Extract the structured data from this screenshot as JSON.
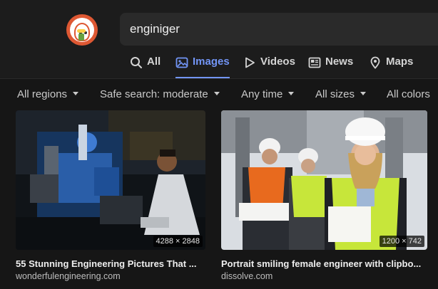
{
  "search": {
    "query": "enginiger"
  },
  "tabs": [
    {
      "label": "All",
      "icon": "search-icon"
    },
    {
      "label": "Images",
      "icon": "image-icon",
      "active": true
    },
    {
      "label": "Videos",
      "icon": "play-icon"
    },
    {
      "label": "News",
      "icon": "newspaper-icon"
    },
    {
      "label": "Maps",
      "icon": "map-pin-icon"
    }
  ],
  "filters": [
    {
      "label": "All regions"
    },
    {
      "label": "Safe search: moderate"
    },
    {
      "label": "Any time"
    },
    {
      "label": "All sizes"
    },
    {
      "label": "All colors"
    }
  ],
  "results": [
    {
      "title": "55 Stunning Engineering Pictures That ...",
      "source": "wonderfulengineering.com",
      "dimensions": "4288 × 2848"
    },
    {
      "title": "Portrait smiling female engineer with clipbo...",
      "source": "dissolve.com",
      "dimensions": "1200 × 742"
    }
  ],
  "colors": {
    "accent": "#7295f6",
    "brand": "#de5833",
    "background": "#161616"
  }
}
